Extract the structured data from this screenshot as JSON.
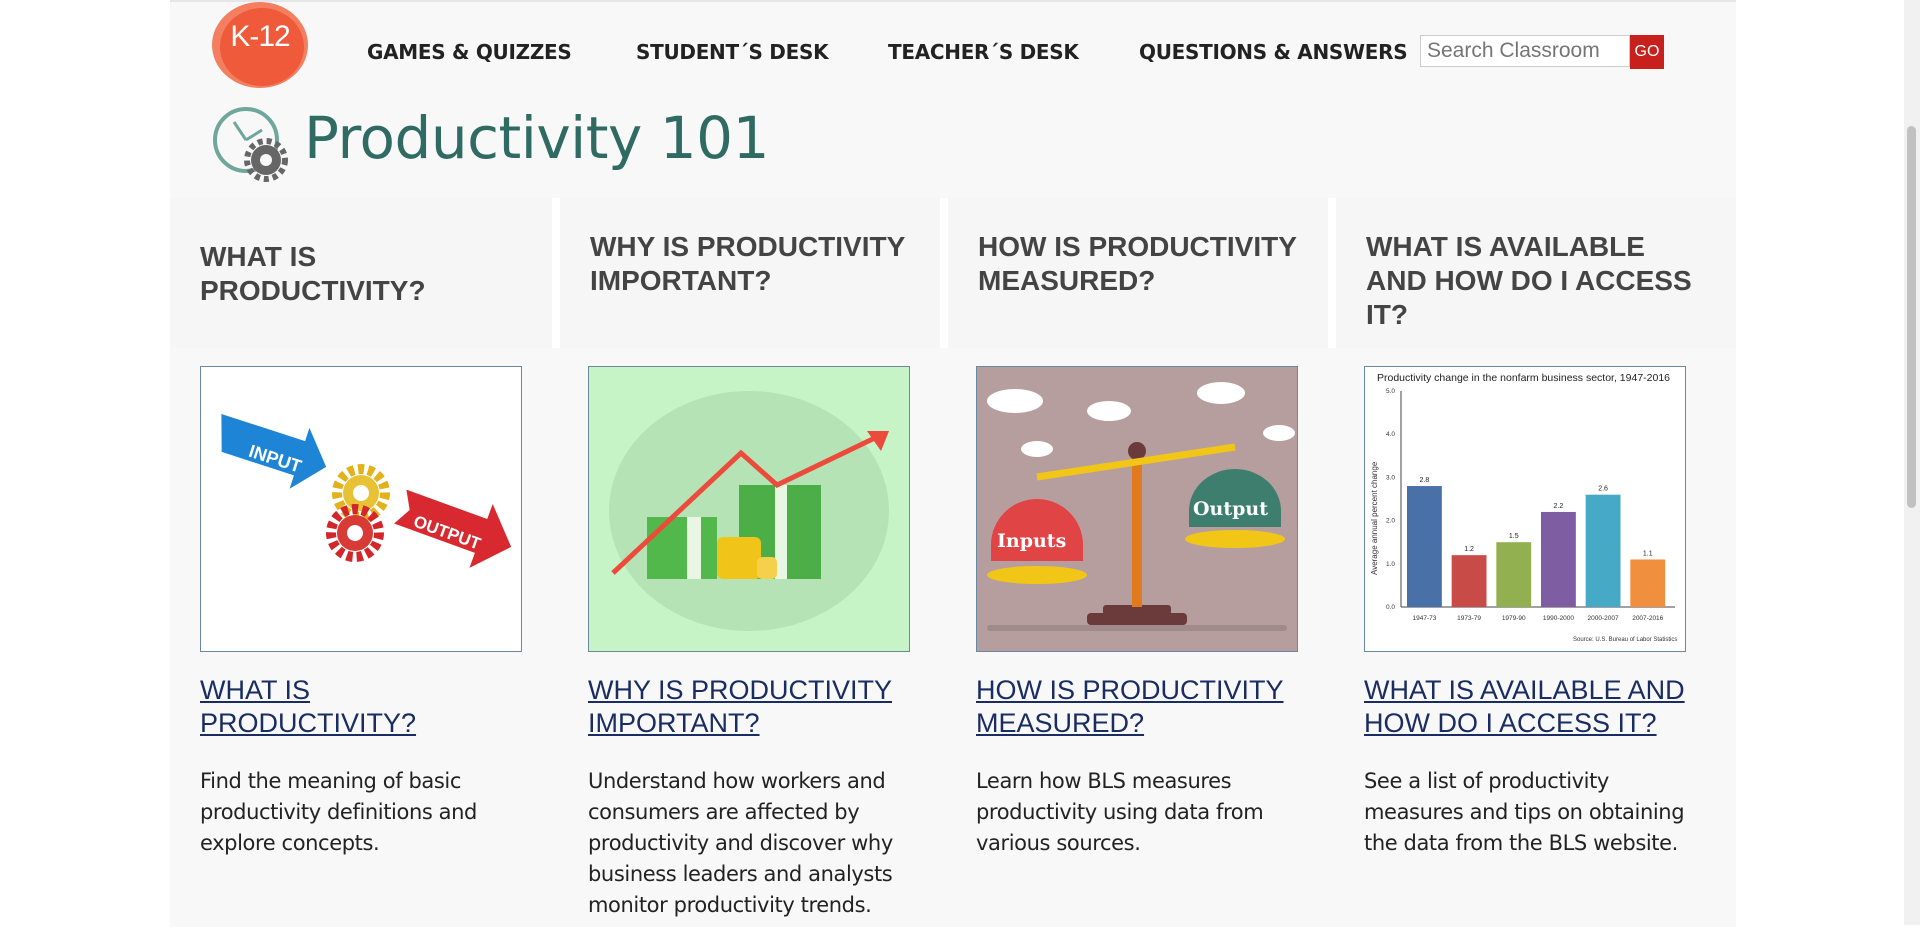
{
  "header": {
    "logo_text": "K-12",
    "nav": [
      {
        "label": "GAMES & QUIZZES"
      },
      {
        "label": "STUDENT´S DESK"
      },
      {
        "label": "TEACHER´S DESK"
      },
      {
        "label": "QUESTIONS & ANSWERS"
      }
    ],
    "search": {
      "placeholder": "Search Classroom",
      "button_label": "GO"
    }
  },
  "page": {
    "title": "Productivity 101"
  },
  "tabs": [
    {
      "label": "WHAT IS PRODUCTIVITY?"
    },
    {
      "label": "WHY IS PRODUCTIVITY IMPORTANT?"
    },
    {
      "label": "HOW IS PRODUCTIVITY MEASURED?"
    },
    {
      "label": "WHAT IS AVAILABLE AND HOW DO I ACCESS IT?"
    }
  ],
  "cards": [
    {
      "link": "WHAT IS PRODUCTIVITY?",
      "desc": "Find the meaning of basic productivity definitions and explore concepts.",
      "img_input": "INPUT",
      "img_output": "OUTPUT"
    },
    {
      "link": "WHY IS PRODUCTIVITY IMPORTANT?",
      "desc": "Understand how workers and consumers are affected by productivity and discover why business leaders and analysts monitor productivity trends."
    },
    {
      "link": "HOW IS PRODUCTIVITY MEASURED?",
      "desc": "Learn how BLS measures productivity using data from various sources.",
      "img_inputs": "Inputs",
      "img_output": "Output"
    },
    {
      "link": "WHAT IS AVAILABLE AND HOW DO I ACCESS IT?",
      "desc": "See a list of productivity measures and tips on obtaining the data from the BLS website."
    }
  ],
  "chart_data": {
    "type": "bar",
    "title": "Productivity change in the nonfarm business sector, 1947-2016",
    "ylabel": "Average annual percent change",
    "xlabel": "",
    "categories": [
      "1947-73",
      "1973-79",
      "1979-90",
      "1990-2000",
      "2000-2007",
      "2007-2016"
    ],
    "values": [
      2.8,
      1.2,
      1.5,
      2.2,
      2.6,
      1.1
    ],
    "value_labels": [
      "2.8",
      "1.2",
      "1.5",
      "2.2",
      "2.6",
      "1.1"
    ],
    "colors": [
      "#4a70a8",
      "#c84b48",
      "#92b04f",
      "#7e5da3",
      "#46a9c6",
      "#f08f3d"
    ],
    "ylim": [
      0,
      5
    ],
    "yticks": [
      "0.0",
      "1.0",
      "2.0",
      "3.0",
      "4.0",
      "5.0"
    ],
    "source": "Source: U.S. Bureau of Labor Statistics",
    "grid": false
  },
  "colors": {
    "accent": "#c8201c",
    "title": "#2f6b63",
    "link": "#1a2d63"
  }
}
